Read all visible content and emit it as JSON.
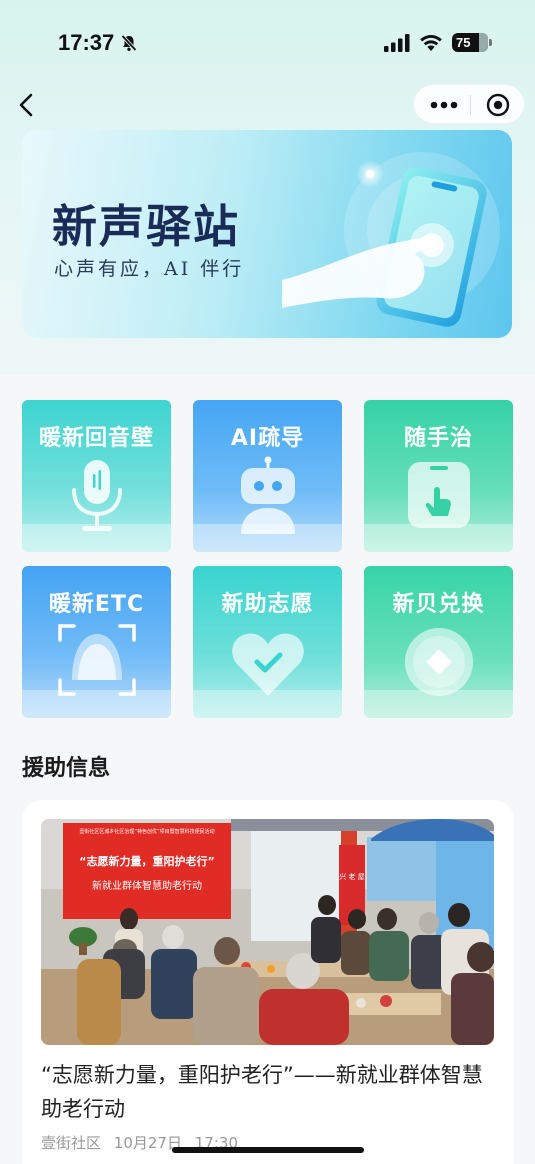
{
  "status_bar": {
    "time": "17:37",
    "battery": "75"
  },
  "banner": {
    "title": "新声驿站",
    "subtitle": "心声有应，AI 伴行"
  },
  "tiles": [
    {
      "label": "暖新回音壁",
      "icon": "microphone-icon",
      "color_top": "#3fd6cf",
      "color_bottom": "#8ee6e0"
    },
    {
      "label": "AI疏导",
      "icon": "robot-icon",
      "color_top": "#4aa8f5",
      "color_bottom": "#9fd2fb"
    },
    {
      "label": "随手治",
      "icon": "phone-tap-icon",
      "color_top": "#37d4a7",
      "color_bottom": "#8ee9cc"
    },
    {
      "label": "暖新ETC",
      "icon": "face-scan-icon",
      "color_top": "#46a5f3",
      "color_bottom": "#a3d3fb"
    },
    {
      "label": "新助志愿",
      "icon": "heart-check-icon",
      "color_top": "#3ad7d0",
      "color_bottom": "#93e8e3"
    },
    {
      "label": "新贝兑换",
      "icon": "coin-icon",
      "color_top": "#3bd7a9",
      "color_bottom": "#95eacf"
    }
  ],
  "section": {
    "title": "援助信息"
  },
  "article": {
    "title": "“志愿新力量，重阳护老行”——新就业群体智慧助老行动",
    "community": "壹街社区",
    "date": "10月27日",
    "time": "17:30",
    "photo": {
      "banner_headline": "“志愿新力量，重阳护老行”",
      "banner_subline": "新就业群体智慧助老行动",
      "banner_top": "壹街社区区城乡社区治理“特色创优”项目暨智慧科技便民活动",
      "side_sign": "兴 老 屋"
    }
  }
}
